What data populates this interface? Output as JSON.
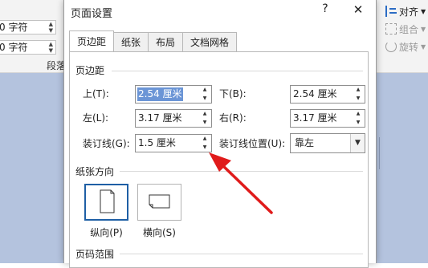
{
  "ribbon": {
    "indent_left": "0 字符",
    "indent_right": "0 字符",
    "group_label": "段落",
    "align_label": "对齐",
    "group_obj_label": "组合",
    "rotate_label": "旋转"
  },
  "dialog": {
    "title": "页面设置",
    "help_glyph": "?",
    "close_glyph": "✕",
    "tabs": [
      {
        "label": "页边距"
      },
      {
        "label": "纸张"
      },
      {
        "label": "布局"
      },
      {
        "label": "文档网格"
      }
    ],
    "margins": {
      "section_title": "页边距",
      "top_label": "上(T):",
      "top_value": "2.54 厘米",
      "bottom_label": "下(B):",
      "bottom_value": "2.54 厘米",
      "left_label": "左(L):",
      "left_value": "3.17 厘米",
      "right_label": "右(R):",
      "right_value": "3.17 厘米",
      "gutter_label": "装订线(G):",
      "gutter_value": "1.5 厘米",
      "gutter_pos_label": "装订线位置(U):",
      "gutter_pos_value": "靠左"
    },
    "orientation": {
      "section_title": "纸张方向",
      "portrait_label": "纵向(P)",
      "landscape_label": "横向(S)",
      "selected": "portrait"
    },
    "pages": {
      "section_title": "页码范围"
    }
  },
  "icons": {
    "spin_up": "▲",
    "spin_down": "▼",
    "dropdown": "▼"
  },
  "colors": {
    "selection": "#6b95d6",
    "selected_border": "#1f5fa5",
    "annotation_arrow": "#e01b1b",
    "document_bg": "#b4c3de"
  }
}
